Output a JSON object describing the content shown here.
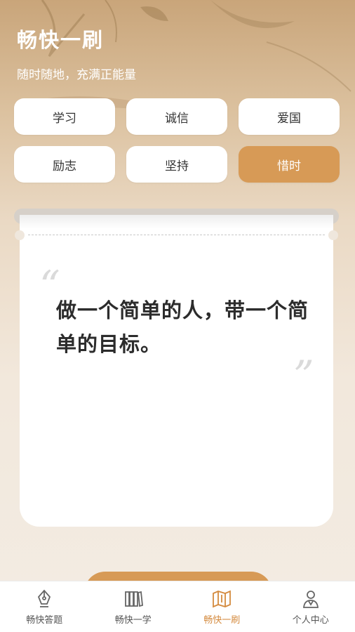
{
  "header": {
    "title": "畅快一刷",
    "subtitle": "随时随地，充满正能量"
  },
  "tags": [
    {
      "label": "学习",
      "active": false
    },
    {
      "label": "诚信",
      "active": false
    },
    {
      "label": "爱国",
      "active": false
    },
    {
      "label": "励志",
      "active": false
    },
    {
      "label": "坚持",
      "active": false
    },
    {
      "label": "惜时",
      "active": true
    }
  ],
  "card": {
    "open_quote": "“",
    "close_quote": "”",
    "text": "做一个简单的人，带一个简单的目标。"
  },
  "tabbar": [
    {
      "label": "畅快答题",
      "icon": "pen-nib-icon",
      "active": false
    },
    {
      "label": "畅快一学",
      "icon": "books-icon",
      "active": false
    },
    {
      "label": "畅快一刷",
      "icon": "map-icon",
      "active": true
    },
    {
      "label": "个人中心",
      "icon": "person-icon",
      "active": false
    }
  ],
  "colors": {
    "accent": "#d79a56",
    "tab_active": "#d48a3e"
  }
}
